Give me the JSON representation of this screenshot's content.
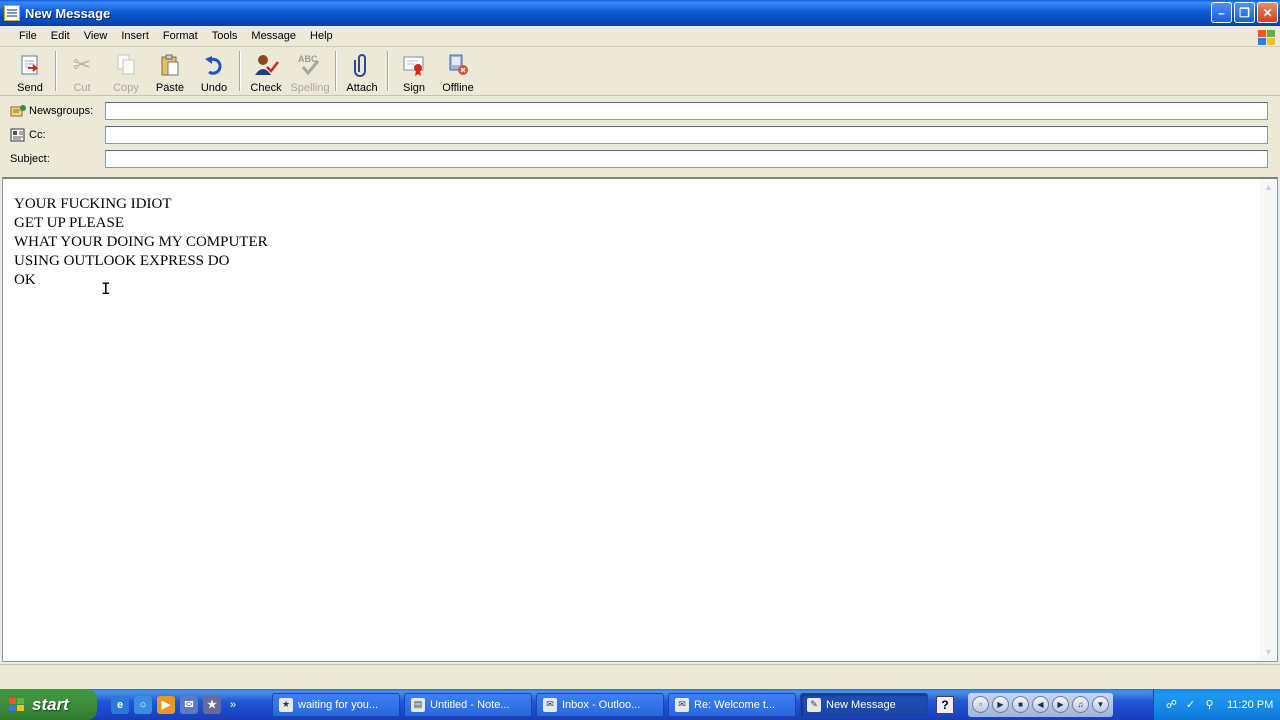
{
  "window": {
    "title": "New Message"
  },
  "menu": [
    "File",
    "Edit",
    "View",
    "Insert",
    "Format",
    "Tools",
    "Message",
    "Help"
  ],
  "toolbar": {
    "send": "Send",
    "cut": "Cut",
    "copy": "Copy",
    "paste": "Paste",
    "undo": "Undo",
    "check": "Check",
    "spelling": "Spelling",
    "attach": "Attach",
    "sign": "Sign",
    "offline": "Offline"
  },
  "headers": {
    "newsgroups_label": "Newsgroups:",
    "newsgroups_value": "",
    "cc_label": "Cc:",
    "cc_value": "",
    "subject_label": "Subject:",
    "subject_value": ""
  },
  "body": {
    "lines": [
      "YOUR FUCKING IDIOT",
      "GET UP PLEASE",
      "WHAT YOUR DOING MY COMPUTER",
      "USING OUTLOOK EXPRESS DO",
      "OK"
    ]
  },
  "taskbar": {
    "start_label": "start",
    "more_label": "»",
    "tasks": [
      {
        "label": "waiting for you...",
        "active": false
      },
      {
        "label": "Untitled - Note...",
        "active": false
      },
      {
        "label": "Inbox - Outloo...",
        "active": false
      },
      {
        "label": "Re: Welcome t...",
        "active": false
      },
      {
        "label": "New Message",
        "active": true
      }
    ],
    "help_label": "?",
    "clock": "11:20 PM"
  },
  "colors": {
    "titlebar": "#0b5bd5",
    "taskbar": "#2157d7",
    "start_button": "#3f8f3f",
    "tray": "#1c9af2"
  }
}
